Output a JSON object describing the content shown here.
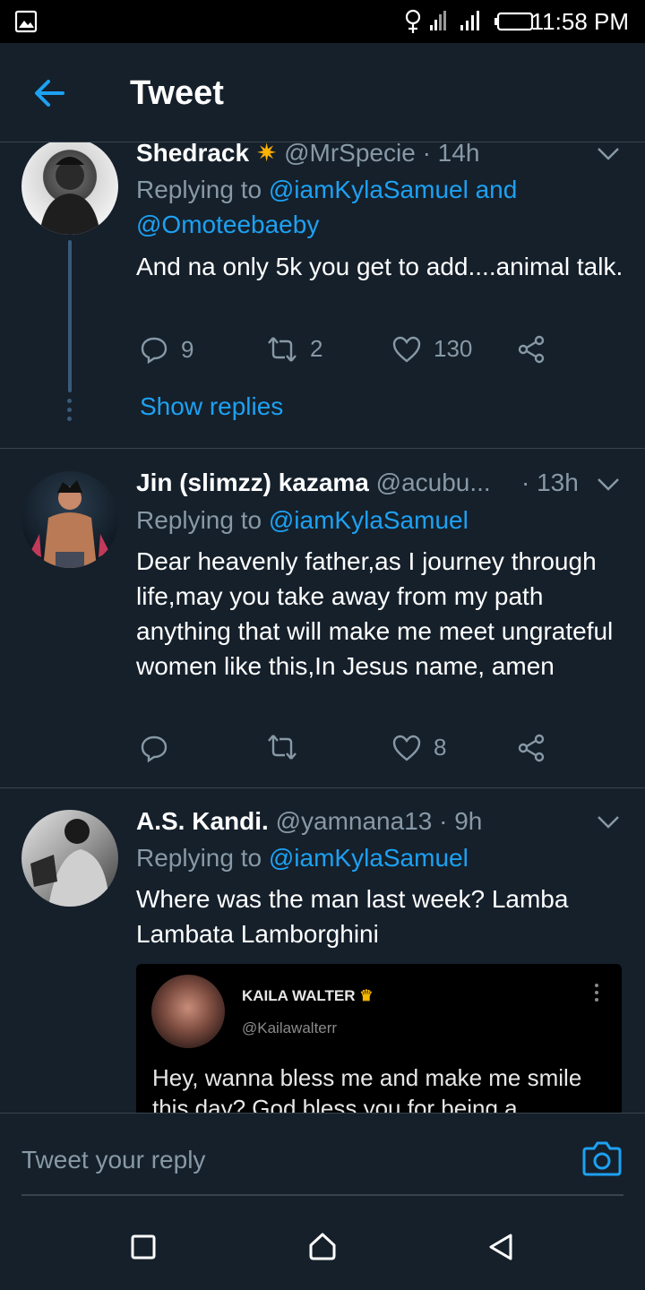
{
  "status": {
    "time": "11:58 PM"
  },
  "header": {
    "title": "Tweet"
  },
  "tweets": [
    {
      "name": "Shedrack",
      "handle": "@MrSpecie",
      "time": "· 14h",
      "replying_prefix": "Replying to",
      "replying_to_1": "@iamKylaSamuel and",
      "replying_to_2": "@Omoteebaeby",
      "text": "And na only 5k you get to add....animal talk.",
      "replies": "9",
      "retweets": "2",
      "likes": "130",
      "show_replies": "Show replies"
    },
    {
      "name": "Jin (slimzz) kazama",
      "handle": "@acubu...",
      "time": "· 13h",
      "replying_prefix": "Replying to",
      "replying_to_1": "@iamKylaSamuel",
      "text": "Dear heavenly father,as I journey through life,may you take away from my path anything that will make me meet ungrateful women like this,In Jesus name, amen",
      "replies": "",
      "retweets": "",
      "likes": "8"
    },
    {
      "name": "A.S. Kandi.",
      "handle": "@yamnana13",
      "time": "· 9h",
      "replying_prefix": "Replying to",
      "replying_to_1": "@iamKylaSamuel",
      "text": "Where was the man last week? Lamba Lambata Lamborghini",
      "quote": {
        "name": "KAILA WALTER",
        "handle": "@Kailawalterr",
        "text": "Hey, wanna bless me and make me smile this day? God bless you for being a"
      }
    }
  ],
  "reply_bar": {
    "placeholder": "Tweet your reply"
  },
  "colors": {
    "background": "#15202b",
    "accent": "#1da1f2",
    "muted": "#8899a6"
  }
}
